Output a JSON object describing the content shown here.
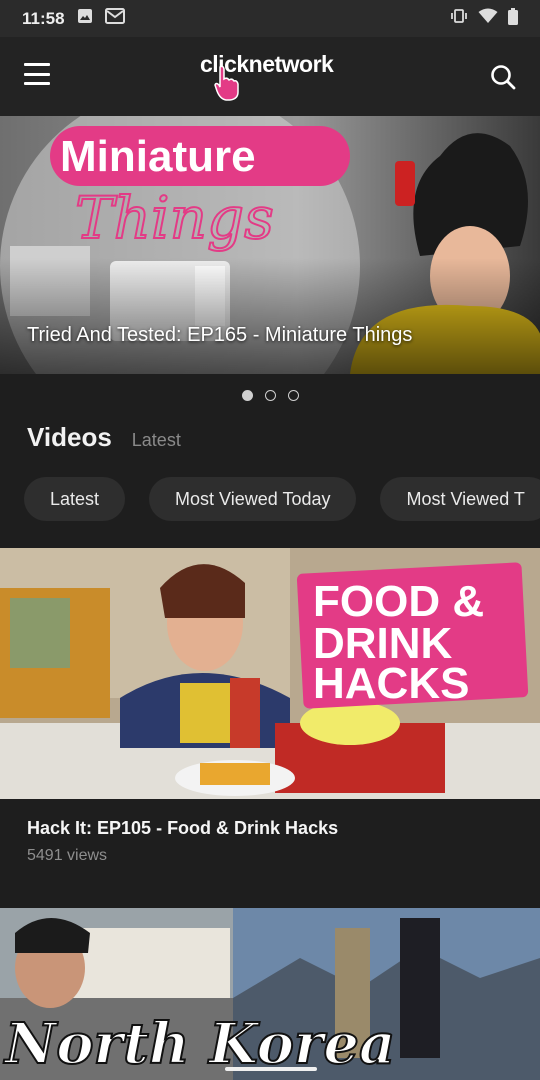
{
  "status": {
    "time": "11:58"
  },
  "appbar": {
    "logo": "clicknetwork"
  },
  "hero": {
    "title": "Tried And Tested: EP165 - Miniature Things",
    "art_word1": "Miniature",
    "art_word2": "Things",
    "pages": 3,
    "active_page": 1
  },
  "videos": {
    "title": "Videos",
    "subtitle": "Latest",
    "chips": [
      "Latest",
      "Most Viewed Today",
      "Most Viewed T"
    ]
  },
  "cards": [
    {
      "title": "Hack It: EP105 - Food & Drink Hacks",
      "views": "5491 views",
      "art_text": [
        "FOOD &",
        "DRINK",
        "HACKS"
      ]
    },
    {
      "art_text": "North Korea"
    }
  ],
  "colors": {
    "background": "#1e1e1e",
    "appbar": "#232323",
    "chip": "#2e2e2e",
    "accent_pink": "#e33b86"
  }
}
